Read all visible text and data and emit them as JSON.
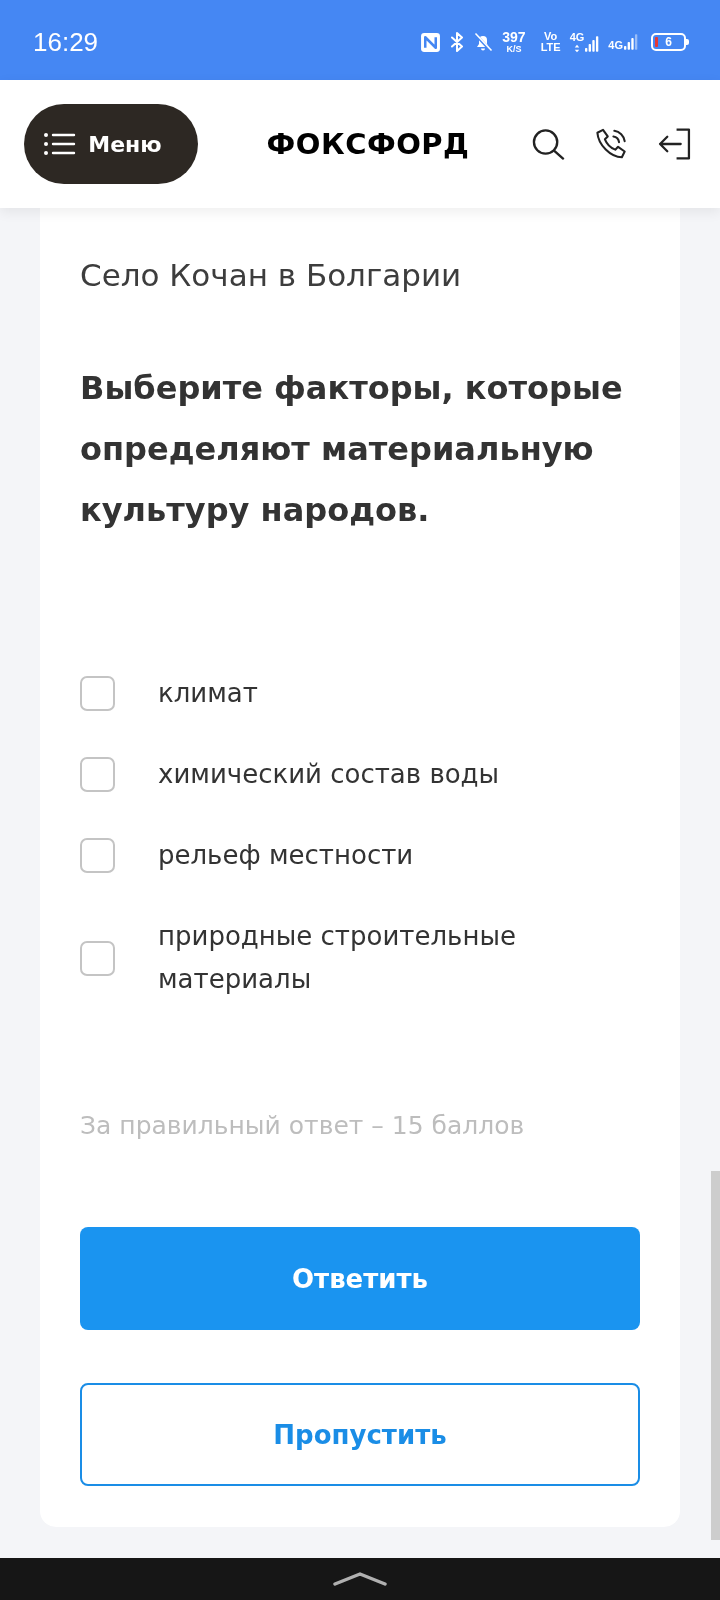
{
  "status_bar": {
    "time": "16:29",
    "data_speed": {
      "value": "397",
      "unit": "K/S"
    },
    "volte": {
      "top": "Vo",
      "bottom": "LTE"
    },
    "networks": [
      {
        "label": "4G",
        "kind": "data"
      },
      {
        "label": "4G",
        "kind": "signal"
      }
    ],
    "battery": {
      "text": "6"
    }
  },
  "header": {
    "menu_button": "Меню",
    "logo": "ФОКСФОРД"
  },
  "task": {
    "title": "Село Кочан в Болгарии",
    "question": "Выберите факторы, которые определяют материальную культуру народов.",
    "options": [
      {
        "label": "климат",
        "checked": false
      },
      {
        "label": "химический состав воды",
        "checked": false
      },
      {
        "label": "рельеф местности",
        "checked": false
      },
      {
        "label": "природные строительные материалы",
        "checked": false
      }
    ],
    "score_note": "За правильный ответ – 15 баллов",
    "buttons": [
      {
        "label": "Ответить",
        "kind": "primary"
      },
      {
        "label": "Пропустить",
        "kind": "secondary"
      }
    ]
  }
}
